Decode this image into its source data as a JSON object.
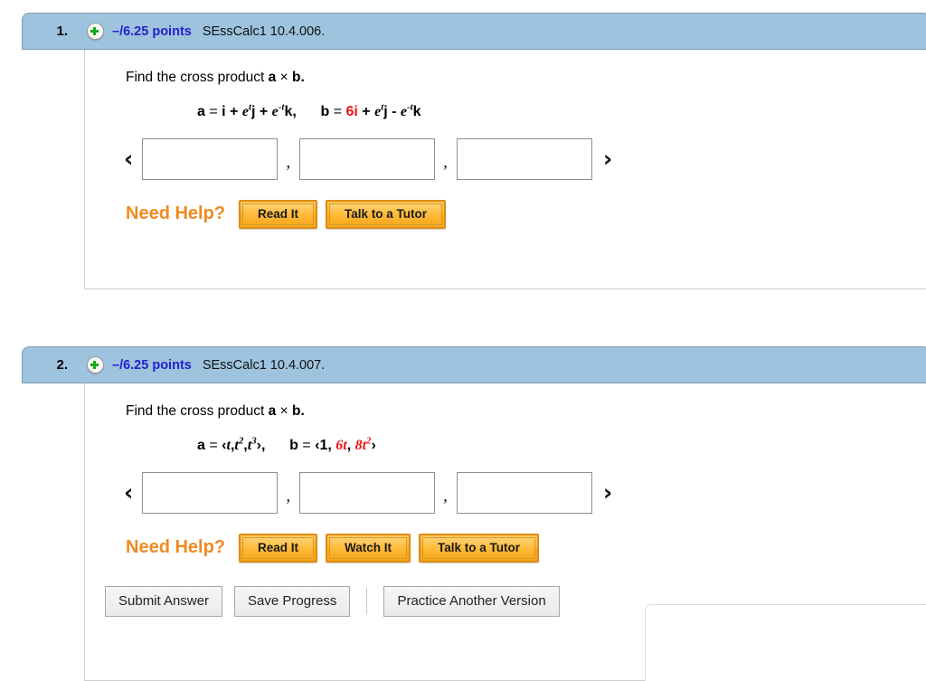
{
  "page": {
    "background": "#ffffff",
    "accent_blue": "#9ec3de",
    "points_color": "#2222cc",
    "highlight_red": "#ee1111",
    "help_orange": "#f08a20"
  },
  "questions": [
    {
      "number": "1.",
      "add_icon": "plus-circle-icon",
      "points": "–/6.25 points",
      "reference": "SEssCalc1 10.4.006.",
      "prompt_prefix": "Find the cross product ",
      "prompt_a": "a",
      "prompt_times": "×",
      "prompt_b": "b",
      "prompt_suffix": ".",
      "vector_a": {
        "name": "a",
        "eq": "=",
        "terms": "i + e{t}j + e{-t}k,"
      },
      "vector_b": {
        "name": "b",
        "eq": "=",
        "coefficient": "6",
        "terms": "i + e{t}j - e{-t}k"
      },
      "answer": {
        "open_bracket": "‹",
        "close_bracket": "›",
        "separator": ",",
        "fields": [
          {
            "value": "",
            "placeholder": ""
          },
          {
            "value": "",
            "placeholder": ""
          },
          {
            "value": "",
            "placeholder": ""
          }
        ]
      },
      "help": {
        "label": "Need Help?",
        "buttons": [
          "Read It",
          "Talk to a Tutor"
        ]
      }
    },
    {
      "number": "2.",
      "add_icon": "plus-circle-icon",
      "points": "–/6.25 points",
      "reference": "SEssCalc1 10.4.007.",
      "prompt_prefix": "Find the cross product ",
      "prompt_a": "a",
      "prompt_times": "×",
      "prompt_b": "b",
      "prompt_suffix": ".",
      "vector_a": {
        "name": "a",
        "eq": "=",
        "terms": "‹t,t2,t3›,"
      },
      "vector_b": {
        "name": "b",
        "eq": "=",
        "terms": "‹1, 6t, 8t2›"
      },
      "answer": {
        "open_bracket": "‹",
        "close_bracket": "›",
        "separator": ",",
        "fields": [
          {
            "value": "",
            "placeholder": ""
          },
          {
            "value": "",
            "placeholder": ""
          },
          {
            "value": "",
            "placeholder": ""
          }
        ]
      },
      "help": {
        "label": "Need Help?",
        "buttons": [
          "Read It",
          "Watch It",
          "Talk to a Tutor"
        ]
      }
    }
  ],
  "action_bar": {
    "submit_label": "Submit Answer",
    "save_label": "Save Progress",
    "practice_label": "Practice Another Version"
  }
}
